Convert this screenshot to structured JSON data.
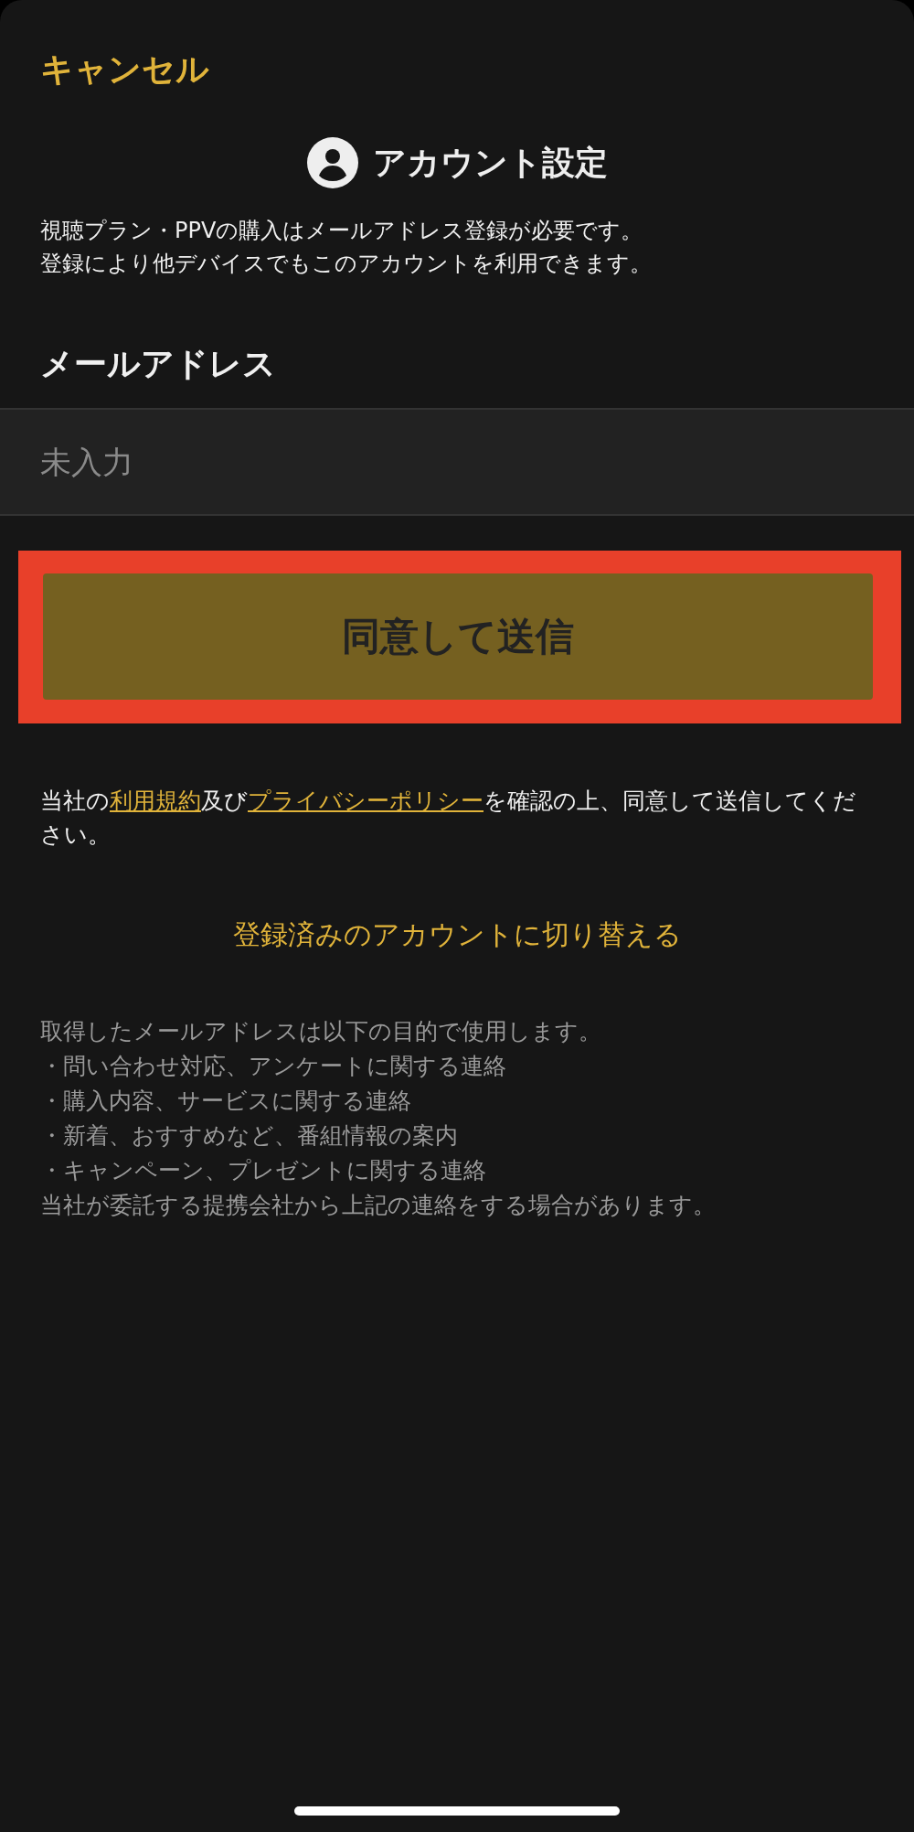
{
  "cancel": "キャンセル",
  "header": {
    "title": "アカウント設定"
  },
  "description": [
    "視聴プラン・PPVの購入はメールアドレス登録が必要です。",
    "登録により他デバイスでもこのアカウントを利用できます。"
  ],
  "email": {
    "label": "メールアドレス",
    "placeholder": "未入力"
  },
  "submit": {
    "label": "同意して送信",
    "disabled": true,
    "highlighted": true
  },
  "consent": [
    {
      "kind": "text",
      "text": "当社の"
    },
    {
      "kind": "link",
      "text": "利用規約"
    },
    {
      "kind": "text",
      "text": "及び"
    },
    {
      "kind": "link",
      "text": "プライバシーポリシー"
    },
    {
      "kind": "text",
      "text": "を確認の上、同意して送信してください。"
    }
  ],
  "switch_account": "登録済みのアカウントに切り替える",
  "notice": [
    "取得したメールアドレスは以下の目的で使用します。",
    "・問い合わせ対応、アンケートに関する連絡",
    "・購入内容、サービスに関する連絡",
    "・新着、おすすめなど、番組情報の案内",
    "・キャンペーン、プレゼントに関する連絡",
    "当社が委託する提携会社から上記の連絡をする場合があります。"
  ]
}
